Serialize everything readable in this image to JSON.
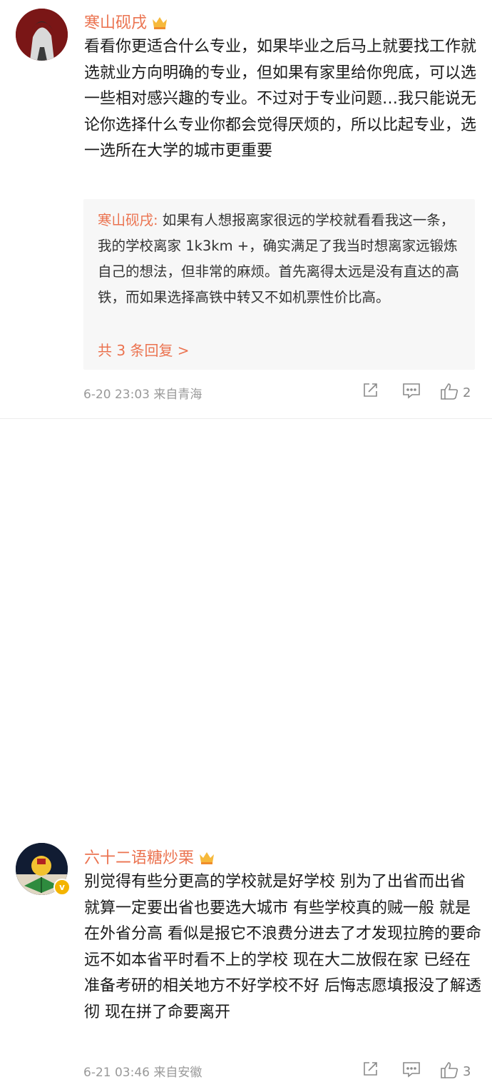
{
  "comments": [
    {
      "username": "寒山砚戌",
      "text": "看看你更适合什么专业，如果毕业之后马上就要找工作就选就业方向明确的专业，但如果有家里给你兜底，可以选一些相对感兴趣的专业。不过对于专业问题…我只能说无论你选择什么专业你都会觉得厌烦的，所以比起专业，选一选所在大学的城市更重要",
      "reply": {
        "author": "寒山砚戌:",
        "text": " 如果有人想报离家很远的学校就看看我这一条，我的学校离家 1k3km +，确实满足了我当时想离家远锻炼自己的想法，但非常的麻烦。首先离得太远是没有直达的高铁，而如果选择高铁中转又不如机票性价比高。",
        "count_label": "共 3 条回复 >"
      },
      "meta": "6-20 23:03  来自青海",
      "likes": "2"
    },
    {
      "username": "六十二语糖炒栗",
      "text": "别觉得有些分更高的学校就是好学校 别为了出省而出省 就算一定要出省也要选大城市 有些学校真的贼一般 就是在外省分高 看似是报它不浪费分进去了才发现拉胯的要命 远不如本省平时看不上的学校 现在大二放假在家 已经在准备考研的相关地方不好学校不好 后悔志愿填报没了解透彻 现在拼了命要离开",
      "meta": "6-21 03:46  来自安徽",
      "likes": "3"
    }
  ],
  "colors": {
    "accent": "#eb7350",
    "meta": "#999999",
    "reply_bg": "#f7f7f7"
  },
  "icons": [
    "vip-crown-icon",
    "verified-icon",
    "share-icon",
    "comment-icon",
    "like-icon"
  ]
}
